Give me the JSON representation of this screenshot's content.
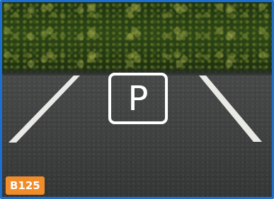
{
  "spot": {
    "sign_letter": "P",
    "label": "B125"
  },
  "colors": {
    "selection_border": "#1d6fd0",
    "badge_background": "#f08c2a",
    "sign_color": "#ffffff"
  },
  "icons": {
    "sign": "parking-sign-icon"
  }
}
